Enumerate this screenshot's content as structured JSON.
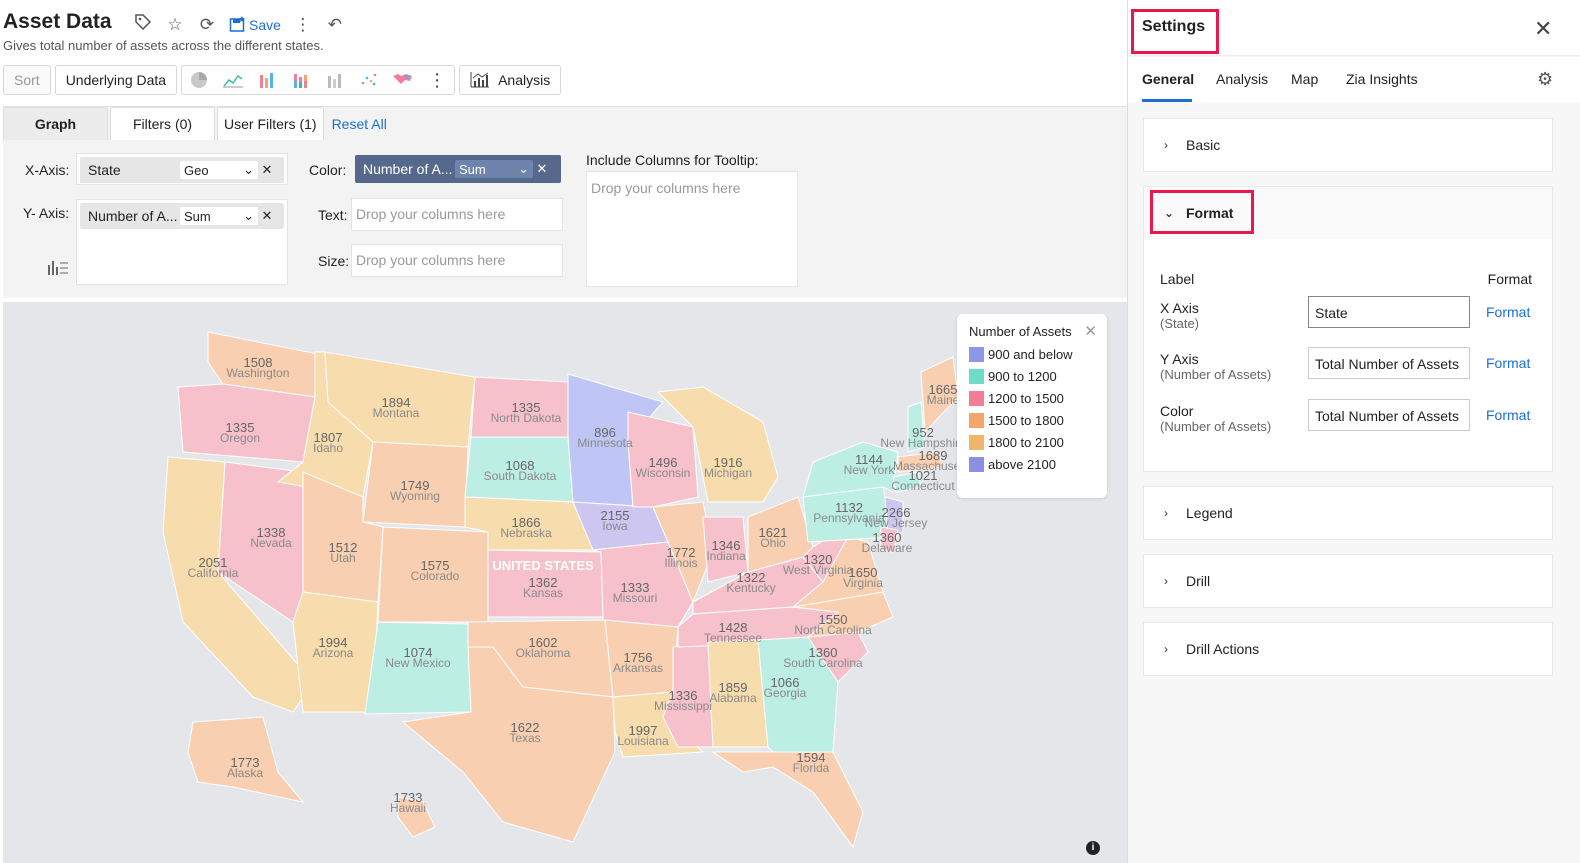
{
  "report": {
    "title": "Asset Data",
    "subtitle": "Gives total number of assets across the different states.",
    "save_label": "Save"
  },
  "toolbar": {
    "sort": "Sort",
    "underlying": "Underlying Data",
    "analysis": "Analysis"
  },
  "config": {
    "tabs": {
      "graph": "Graph",
      "filters": "Filters  (0)",
      "user_filters": "User Filters  (1)",
      "reset": "Reset All"
    },
    "xaxis_label": "X-Axis:",
    "yaxis_label": "Y- Axis:",
    "color_label": "Color:",
    "text_label": "Text:",
    "size_label": "Size:",
    "tooltip_label": "Include Columns for Tooltip:",
    "x_field": "State",
    "x_agg": "Geo",
    "y_field": "Number of A...",
    "y_agg": "Sum",
    "color_field": "Number of A...",
    "color_agg": "Sum",
    "drop_placeholder": "Drop your columns here"
  },
  "map": {
    "legend_title": "Number of Assets",
    "legend": [
      {
        "label": "900 and below",
        "color": "#8b97e8"
      },
      {
        "label": "900 to 1200",
        "color": "#6fdcc8"
      },
      {
        "label": "1200 to 1500",
        "color": "#f27d95"
      },
      {
        "label": "1500 to 1800",
        "color": "#f4a56c"
      },
      {
        "label": "1800 to 2100",
        "color": "#f0b46a"
      },
      {
        "label": "above 2100",
        "color": "#8e8fe2"
      }
    ],
    "country_label": "UNITED STATES",
    "states": [
      {
        "name": "Washington",
        "value": "1508"
      },
      {
        "name": "Oregon",
        "value": "1335"
      },
      {
        "name": "California",
        "value": "2051"
      },
      {
        "name": "Nevada",
        "value": "1338"
      },
      {
        "name": "Idaho",
        "value": "1807"
      },
      {
        "name": "Montana",
        "value": "1894"
      },
      {
        "name": "Wyoming",
        "value": "1749"
      },
      {
        "name": "Utah",
        "value": "1512"
      },
      {
        "name": "Arizona",
        "value": "1994"
      },
      {
        "name": "Colorado",
        "value": "1575"
      },
      {
        "name": "New Mexico",
        "value": "1074"
      },
      {
        "name": "North Dakota",
        "value": "1335"
      },
      {
        "name": "South Dakota",
        "value": "1068"
      },
      {
        "name": "Nebraska",
        "value": "1866"
      },
      {
        "name": "Kansas",
        "value": "1362"
      },
      {
        "name": "Oklahoma",
        "value": "1602"
      },
      {
        "name": "Texas",
        "value": "1622"
      },
      {
        "name": "Minnesota",
        "value": "896"
      },
      {
        "name": "Iowa",
        "value": "2155"
      },
      {
        "name": "Missouri",
        "value": "1333"
      },
      {
        "name": "Arkansas",
        "value": "1756"
      },
      {
        "name": "Louisiana",
        "value": "1997"
      },
      {
        "name": "Wisconsin",
        "value": "1496"
      },
      {
        "name": "Illinois",
        "value": "1772"
      },
      {
        "name": "Mississippi",
        "value": "1336"
      },
      {
        "name": "Michigan",
        "value": "1916"
      },
      {
        "name": "Indiana",
        "value": "1346"
      },
      {
        "name": "Kentucky",
        "value": "1322"
      },
      {
        "name": "Tennessee",
        "value": "1428"
      },
      {
        "name": "Alabama",
        "value": "1859"
      },
      {
        "name": "Georgia",
        "value": "1066"
      },
      {
        "name": "Florida",
        "value": "1594"
      },
      {
        "name": "Ohio",
        "value": "1621"
      },
      {
        "name": "South Carolina",
        "value": "1360"
      },
      {
        "name": "North Carolina",
        "value": "1550"
      },
      {
        "name": "Virginia",
        "value": "1650"
      },
      {
        "name": "West Virginia",
        "value": "1320"
      },
      {
        "name": "Pennsylvania",
        "value": "1132"
      },
      {
        "name": "New York",
        "value": "1144"
      },
      {
        "name": "New Jersey",
        "value": "2266"
      },
      {
        "name": "Delaware",
        "value": "1360"
      },
      {
        "name": "Connecticut",
        "value": "1021"
      },
      {
        "name": "Massachusetts",
        "value": "1689"
      },
      {
        "name": "New Hampshire",
        "value": "952"
      },
      {
        "name": "Maine",
        "value": "1665"
      },
      {
        "name": "Alaska",
        "value": "1773"
      },
      {
        "name": "Hawaii",
        "value": "1733"
      }
    ]
  },
  "settings": {
    "title": "Settings",
    "tabs": [
      "General",
      "Analysis",
      "Map",
      "Zia Insights"
    ],
    "sections": {
      "basic": "Basic",
      "format": "Format",
      "legend": "Legend",
      "drill": "Drill",
      "drill_actions": "Drill Actions"
    },
    "format_head_label": "Label",
    "format_head_format": "Format",
    "rows": [
      {
        "label": "X Axis",
        "sub": "(State)",
        "value": "State",
        "link": "Format"
      },
      {
        "label": "Y Axis",
        "sub": "(Number of Assets)",
        "value": "Total Number of Assets",
        "link": "Format"
      },
      {
        "label": "Color",
        "sub": "(Number of Assets)",
        "value": "Total Number of Assets",
        "link": "Format"
      }
    ]
  }
}
